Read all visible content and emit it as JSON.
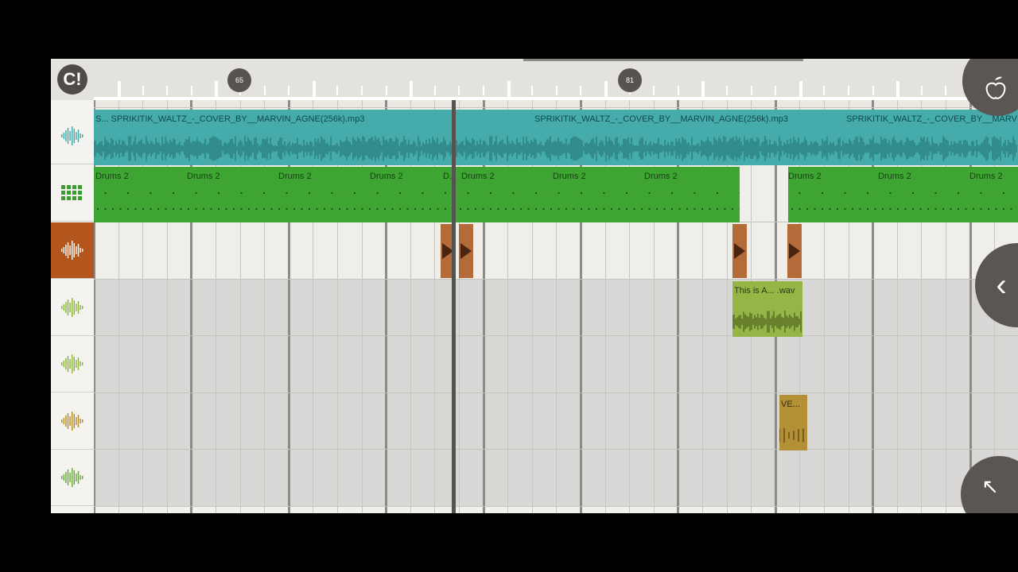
{
  "ruler": {
    "markers": [
      "65",
      "81"
    ]
  },
  "logo": {
    "glyph": "C!"
  },
  "tracks": [
    {
      "id": "audio-main",
      "icon": "waveform-icon",
      "color": "#41a8a8"
    },
    {
      "id": "drums",
      "icon": "drum-pads-icon",
      "color": "#3a9b30"
    },
    {
      "id": "sample",
      "icon": "waveform-icon",
      "color": "#b2561e"
    },
    {
      "id": "audio-2",
      "icon": "waveform-icon",
      "color": "#8ab43b"
    },
    {
      "id": "audio-3",
      "icon": "waveform-icon",
      "color": "#8ab43b"
    },
    {
      "id": "audio-4",
      "icon": "waveform-icon",
      "color": "#b78a2a"
    },
    {
      "id": "audio-5",
      "icon": "waveform-icon",
      "color": "#69a63a"
    }
  ],
  "clips": {
    "mp3": [
      "S...  SPRIKITIK_WALTZ_-_COVER_BY__MARVIN_AGNE(256k).mp3",
      "SPRIKITIK_WALTZ_-_COVER_BY__MARVIN_AGNE(256k).mp3",
      "SPRIKITIK_WALTZ_-_COVER_BY__MARVIN"
    ],
    "drums": [
      "Drums 2",
      "Drums 2",
      "Drums 2",
      "Drums 2",
      "D...",
      "Drums 2",
      "Drums 2",
      "Drums 2",
      "Drums 2",
      "Drums 2",
      "Drums 2"
    ],
    "wav": "This is A... .wav",
    "ve": "VE..."
  },
  "buttons": {
    "collapse": "‹",
    "expand": "↖"
  }
}
